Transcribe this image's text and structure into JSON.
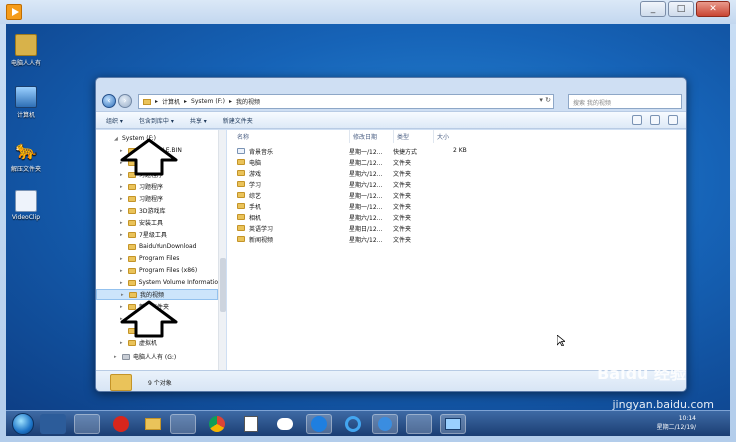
{
  "host": {
    "title_icon": "media-player-icon",
    "controls": [
      "_",
      "□",
      "✕"
    ]
  },
  "desktop_icons": [
    {
      "label": "电脑人人有",
      "icon": "user-folder-icon"
    },
    {
      "label": "计算机",
      "icon": "computer-icon"
    },
    {
      "label": "解压文件夹",
      "icon": "panther-icon"
    },
    {
      "label": "VideoClip",
      "icon": "video-file-icon"
    }
  ],
  "explorer": {
    "address": {
      "crumbs": [
        "计算机",
        "System (F:)",
        "我的视频"
      ],
      "search_placeholder": "搜索 我的视频"
    },
    "toolbar": {
      "organize": "组织 ▾",
      "include_in_library": "包含到库中 ▾",
      "share": "共享 ▾",
      "new_folder": "新建文件夹"
    },
    "nav_tree": [
      {
        "label": "System (F:)",
        "level": 0
      },
      {
        "label": "$RECYCLE.BIN",
        "level": 1
      },
      {
        "label": "360",
        "level": 1
      },
      {
        "label": "习题程序",
        "level": 1
      },
      {
        "label": "习题程序",
        "level": 1
      },
      {
        "label": "习题程序",
        "level": 1
      },
      {
        "label": "3D游戏库",
        "level": 1
      },
      {
        "label": "安装工具",
        "level": 1
      },
      {
        "label": "7星级工具",
        "level": 1
      },
      {
        "label": "BaiduYunDownload",
        "level": 1
      },
      {
        "label": "Program Files",
        "level": 1
      },
      {
        "label": "Program Files (x86)",
        "level": 1
      },
      {
        "label": "System Volume Informatio",
        "level": 1
      },
      {
        "label": "我的视频",
        "level": 1,
        "selected": true
      },
      {
        "label": "新建文件夹",
        "level": 1
      },
      {
        "label": "音乐",
        "level": 1
      },
      {
        "label": "下载",
        "level": 1
      },
      {
        "label": "虚拟机",
        "level": 1
      },
      {
        "label": "电脑人人有 (G:)",
        "level": 0
      }
    ],
    "columns": [
      "名称",
      "修改日期",
      "类型",
      "大小"
    ],
    "rows": [
      {
        "name": "背景音乐",
        "date": "星期一/12...",
        "type": "快捷方式",
        "size": "2 KB",
        "link": true
      },
      {
        "name": "电脑",
        "date": "星期二/12...",
        "type": "文件夹",
        "size": ""
      },
      {
        "name": "游戏",
        "date": "星期六/12...",
        "type": "文件夹",
        "size": ""
      },
      {
        "name": "学习",
        "date": "星期六/12...",
        "type": "文件夹",
        "size": ""
      },
      {
        "name": "综艺",
        "date": "星期一/12...",
        "type": "文件夹",
        "size": ""
      },
      {
        "name": "手机",
        "date": "星期一/12...",
        "type": "文件夹",
        "size": ""
      },
      {
        "name": "相机",
        "date": "星期六/12...",
        "type": "文件夹",
        "size": ""
      },
      {
        "name": "英语学习",
        "date": "星期日/12...",
        "type": "文件夹",
        "size": ""
      },
      {
        "name": "新闻视频",
        "date": "星期六/12...",
        "type": "文件夹",
        "size": ""
      }
    ],
    "status": "9 个对象"
  },
  "taskbar": {
    "clock_time": "10:14",
    "clock_date": "星期二/12/19/"
  },
  "watermark": {
    "brand": "Baidu 经验",
    "url": "jingyan.baidu.com"
  }
}
